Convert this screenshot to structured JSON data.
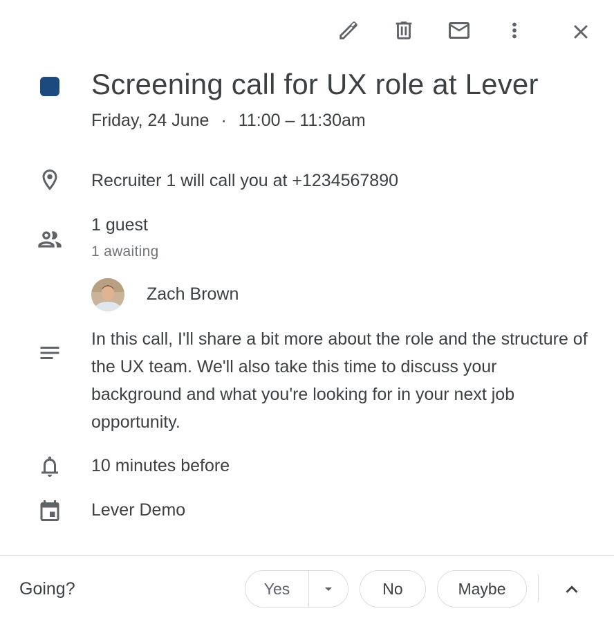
{
  "toolbar": {
    "edit_icon": "pencil-icon",
    "delete_icon": "trash-icon",
    "email_icon": "envelope-icon",
    "more_icon": "more-vert-icon",
    "close_icon": "close-icon"
  },
  "event": {
    "color": "#1c4a7e",
    "title": "Screening call for UX role at Lever",
    "date": "Friday, 24 June",
    "separator": "·",
    "time": "11:00 – 11:30am",
    "location": "Recruiter 1 will call you at +1234567890",
    "guests": {
      "summary": "1 guest",
      "status": "1 awaiting",
      "list": [
        {
          "name": "Zach Brown"
        }
      ]
    },
    "description": "In this call, I'll share a bit more about the role and the structure of the UX team. We'll also take this time to discuss your background and what you're looking for in your next job opportunity.",
    "reminder": "10 minutes before",
    "calendar": "Lever Demo"
  },
  "footer": {
    "going_label": "Going?",
    "yes_label": "Yes",
    "no_label": "No",
    "maybe_label": "Maybe"
  },
  "colors": {
    "text_primary": "#3c4043",
    "text_secondary": "#70757a",
    "icon": "#5f6368",
    "divider": "#dadce0"
  }
}
